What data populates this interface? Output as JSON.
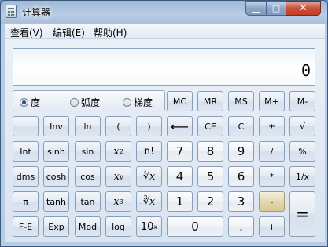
{
  "window": {
    "title": "计算器",
    "minimize_glyph": "▁",
    "maximize_glyph": "□",
    "close_glyph": "✕"
  },
  "menu": {
    "view": "查看(V)",
    "edit": "编辑(E)",
    "help": "帮助(H)"
  },
  "display": {
    "value": "0"
  },
  "angle_mode": {
    "options": [
      "度",
      "弧度",
      "梯度"
    ],
    "selected": "度"
  },
  "keys": {
    "mc": "MC",
    "mr": "MR",
    "ms": "MS",
    "mplus": "M+",
    "mminus": "M-",
    "inv": "Inv",
    "ln": "ln",
    "lparen": "(",
    "rparen": ")",
    "backspace": "⟵",
    "ce": "CE",
    "c": "C",
    "negate": "±",
    "sqrt": "√",
    "int": "Int",
    "sinh": "sinh",
    "sin": "sin",
    "x2": "x",
    "x2sup": "2",
    "fact": "n!",
    "d7": "7",
    "d8": "8",
    "d9": "9",
    "div": "/",
    "pct": "%",
    "dms": "dms",
    "cosh": "cosh",
    "cos": "cos",
    "xy": "x",
    "xysup": "y",
    "yroot": "∜x",
    "d4": "4",
    "d5": "5",
    "d6": "6",
    "mul": "*",
    "recip": "1/x",
    "pi": "π",
    "tanh": "tanh",
    "tan": "tan",
    "x3": "x",
    "x3sup": "3",
    "cbrt": "∛x",
    "d1": "1",
    "d2": "2",
    "d3": "3",
    "sub": "-",
    "eq": "=",
    "fe": "F-E",
    "exp": "Exp",
    "mod": "Mod",
    "log": "log",
    "ten": "10",
    "tensup": "x",
    "d0": "0",
    "dot": ".",
    "add": "+"
  }
}
